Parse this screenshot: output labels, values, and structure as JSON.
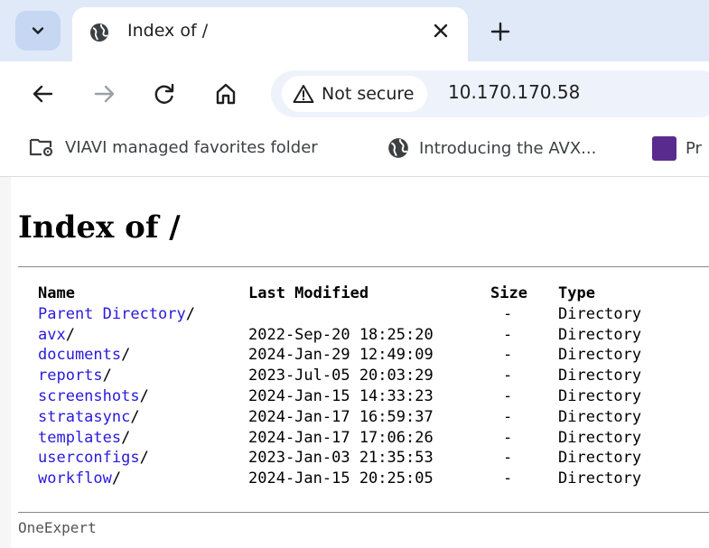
{
  "browser": {
    "tab": {
      "title": "Index of /"
    },
    "address": {
      "security_label": "Not secure",
      "url": "10.170.170.58"
    },
    "bookmarks": [
      {
        "label": "VIAVI managed favorites folder"
      },
      {
        "label": "Introducing the AVX..."
      },
      {
        "label": "Pr"
      }
    ]
  },
  "page": {
    "title": "Index of /",
    "columns": {
      "name": "Name",
      "modified": "Last Modified",
      "size": "Size",
      "type": "Type"
    },
    "entries": [
      {
        "name": "Parent Directory",
        "suffix": "/",
        "modified": "",
        "size": "-",
        "type": "Directory"
      },
      {
        "name": "avx",
        "suffix": "/",
        "modified": "2022-Sep-20 18:25:20",
        "size": "-",
        "type": "Directory"
      },
      {
        "name": "documents",
        "suffix": "/",
        "modified": "2024-Jan-29 12:49:09",
        "size": "-",
        "type": "Directory"
      },
      {
        "name": "reports",
        "suffix": "/",
        "modified": "2023-Jul-05 20:03:29",
        "size": "-",
        "type": "Directory"
      },
      {
        "name": "screenshots",
        "suffix": "/",
        "modified": "2024-Jan-15 14:33:23",
        "size": "-",
        "type": "Directory"
      },
      {
        "name": "stratasync",
        "suffix": "/",
        "modified": "2024-Jan-17 16:59:37",
        "size": "-",
        "type": "Directory"
      },
      {
        "name": "templates",
        "suffix": "/",
        "modified": "2024-Jan-17 17:06:26",
        "size": "-",
        "type": "Directory"
      },
      {
        "name": "userconfigs",
        "suffix": "/",
        "modified": "2023-Jan-03 21:35:53",
        "size": "-",
        "type": "Directory"
      },
      {
        "name": "workflow",
        "suffix": "/",
        "modified": "2024-Jan-15 20:25:05",
        "size": "-",
        "type": "Directory"
      }
    ],
    "footer": "OneExpert"
  },
  "colors": {
    "link": "#2a1adb",
    "tabstrip": "#dfe9f8",
    "bookmark_icon": "#5a2b8e"
  },
  "icons": [
    "chevron-down-icon",
    "globe-icon",
    "close-icon",
    "plus-icon",
    "back-arrow-icon",
    "forward-arrow-icon",
    "reload-icon",
    "home-icon",
    "warning-icon",
    "folder-gear-icon",
    "globe-icon"
  ]
}
